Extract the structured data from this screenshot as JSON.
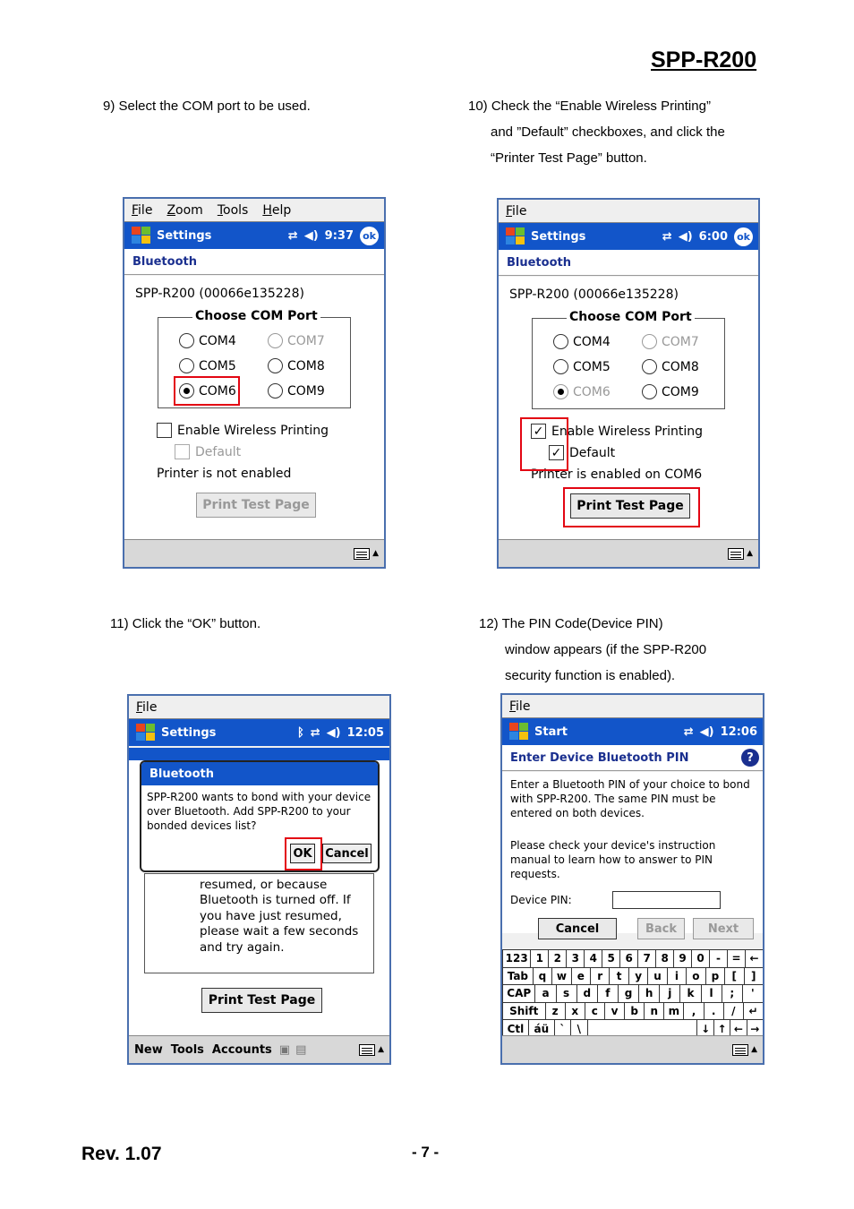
{
  "header": {
    "title": "SPP-R200"
  },
  "steps": {
    "s9": [
      "9) Select the COM port to be used."
    ],
    "s10": [
      "10) Check the “Enable Wireless Printing”",
      "and ”Default” checkboxes, and click the",
      "“Printer Test Page” button."
    ],
    "s11": [
      "11) Click the “OK” button."
    ],
    "s12": [
      "12) The PIN Code(Device PIN)",
      "window appears (if the SPP-R200",
      "security function is enabled)."
    ]
  },
  "screen9": {
    "menu": [
      "File",
      "Zoom",
      "Tools",
      "Help"
    ],
    "title": "Settings",
    "time": "9:37",
    "ok": "ok",
    "heading": "Bluetooth",
    "device": "SPP-R200 (00066e135228)",
    "group": "Choose COM Port",
    "ports": [
      "COM4",
      "COM7",
      "COM5",
      "COM8",
      "COM6",
      "COM9"
    ],
    "enable": "Enable Wireless Printing",
    "default": "Default",
    "status": "Printer is not enabled",
    "button": "Print Test Page"
  },
  "screen10": {
    "menu": [
      "File"
    ],
    "title": "Settings",
    "time": "6:00",
    "ok": "ok",
    "heading": "Bluetooth",
    "device": "SPP-R200 (00066e135228)",
    "group": "Choose COM Port",
    "ports": [
      "COM4",
      "COM7",
      "COM5",
      "COM8",
      "COM6",
      "COM9"
    ],
    "enable": "Enable Wireless Printing",
    "default": "Default",
    "status": "Printer is enabled on COM6",
    "button": "Print Test Page"
  },
  "screen11": {
    "menu": [
      "File"
    ],
    "title": "Settings",
    "time": "12:05",
    "dialog_title": "Bluetooth",
    "dialog_text": "SPP-R200 wants to bond with your device over Bluetooth. Add SPP-R200 to your bonded devices list?",
    "ok": "OK",
    "cancel": "Cancel",
    "behind_text": "resumed, or because Bluetooth is turned off.  If you have just resumed, please wait a few seconds and try again.",
    "button": "Print Test Page",
    "bottom_menu": [
      "New",
      "Tools",
      "Accounts"
    ]
  },
  "screen12": {
    "menu": [
      "File"
    ],
    "title": "Start",
    "time": "12:06",
    "heading": "Enter Device Bluetooth PIN",
    "text1": "Enter a Bluetooth PIN of your choice to bond with SPP-R200. The same PIN must be entered on both devices.",
    "text2": "Please check your device's instruction manual to learn how to answer to PIN requests.",
    "pin_label": "Device PIN:",
    "pin_value": "",
    "cancel": "Cancel",
    "back": "Back",
    "next": "Next",
    "keyboard": [
      [
        "123",
        "1",
        "2",
        "3",
        "4",
        "5",
        "6",
        "7",
        "8",
        "9",
        "0",
        "-",
        "=",
        "←"
      ],
      [
        "Tab",
        "q",
        "w",
        "e",
        "r",
        "t",
        "y",
        "u",
        "i",
        "o",
        "p",
        "[",
        "]"
      ],
      [
        "CAP",
        "a",
        "s",
        "d",
        "f",
        "g",
        "h",
        "j",
        "k",
        "l",
        ";",
        "'"
      ],
      [
        "Shift",
        "z",
        "x",
        "c",
        "v",
        "b",
        "n",
        "m",
        ",",
        ".",
        "/",
        "↵"
      ],
      [
        "Ctl",
        "áü",
        "`",
        "\\",
        "",
        "↓",
        "↑",
        "←",
        "→"
      ]
    ]
  },
  "footer": {
    "rev": "Rev. 1.07",
    "page": "- 7 -"
  }
}
